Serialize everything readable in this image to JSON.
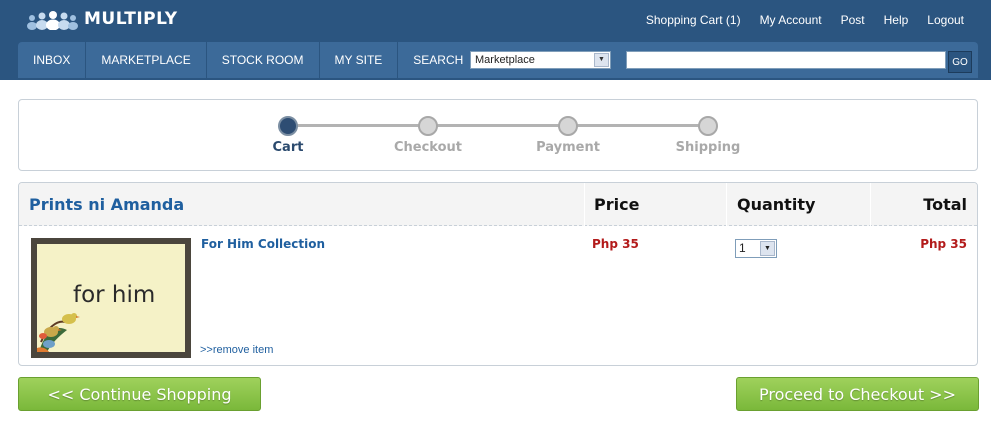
{
  "header": {
    "logo_text": "MULTIPLY",
    "links": {
      "cart": "Shopping Cart (1)",
      "account": "My Account",
      "post": "Post",
      "help": "Help",
      "logout": "Logout"
    }
  },
  "nav": {
    "items": [
      "INBOX",
      "MARKETPLACE",
      "STOCK ROOM",
      "MY SITE",
      "SEARCH"
    ],
    "search_scope": "Marketplace",
    "search_value": "",
    "go_label": "GO"
  },
  "steps": [
    {
      "label": "Cart",
      "active": true
    },
    {
      "label": "Checkout",
      "active": false
    },
    {
      "label": "Payment",
      "active": false
    },
    {
      "label": "Shipping",
      "active": false
    }
  ],
  "cart": {
    "seller": "Prints ni Amanda",
    "columns": {
      "price": "Price",
      "quantity": "Quantity",
      "total": "Total"
    },
    "item": {
      "name": "For Him Collection",
      "thumb_text": "for him",
      "price": "Php 35",
      "quantity": "1",
      "total": "Php 35",
      "remove_label": ">>remove item"
    }
  },
  "buttons": {
    "continue": "<< Continue Shopping",
    "checkout": "Proceed to Checkout >>"
  },
  "colors": {
    "header_bg": "#2b5580",
    "nav_bg": "#3c6a99",
    "link_blue": "#1f5f9f",
    "price_red": "#b31b1b",
    "button_green": "#8cc54b"
  }
}
